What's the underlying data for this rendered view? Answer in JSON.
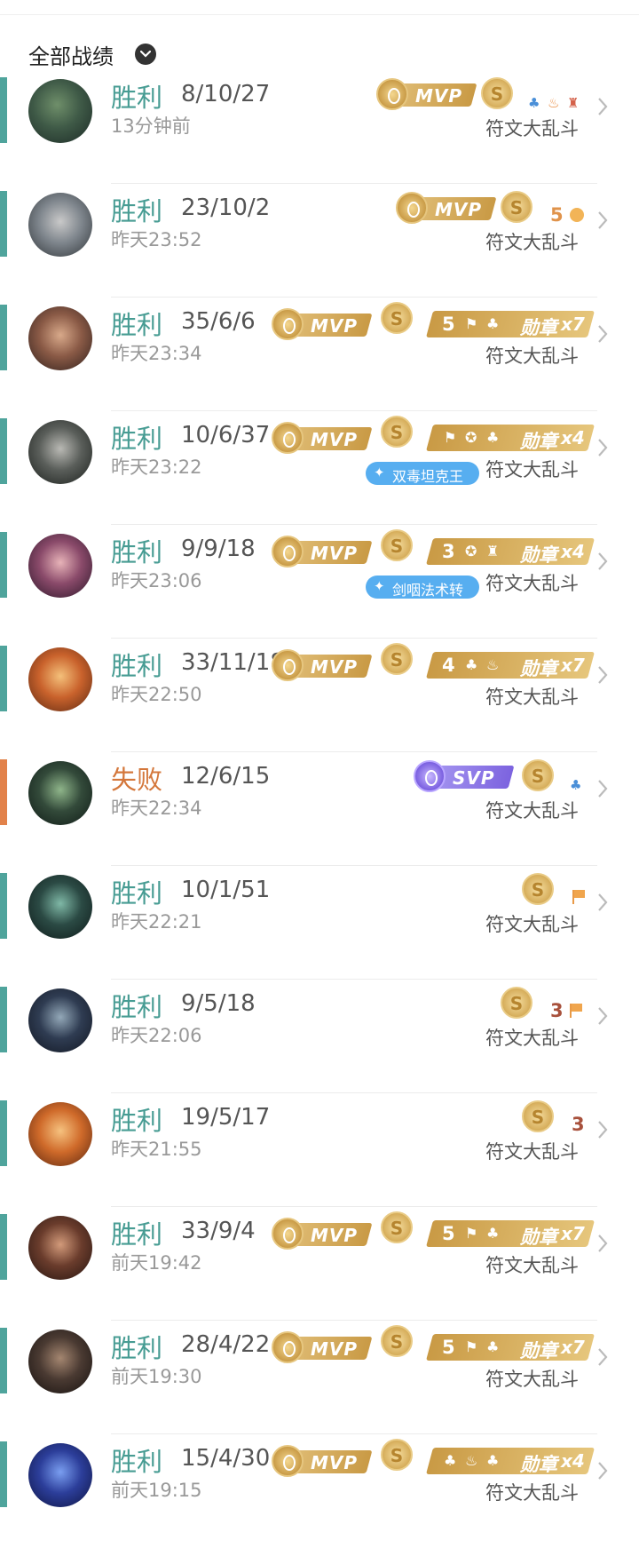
{
  "header": {
    "title": "全部战绩"
  },
  "mode_label": "符文大乱斗",
  "badges": {
    "mvp": "MVP",
    "svp": "SVP",
    "s": "S",
    "medal_word": "勋章"
  },
  "colors": {
    "win": "#479c93",
    "loss": "#d4773b",
    "gold": "#c99a45",
    "svp": "#7c63df",
    "tag": "#57aef0"
  },
  "matches": [
    {
      "result": "胜利",
      "kda": "8/10/27",
      "time": "13分钟前",
      "mode": "符文大乱斗"
    },
    {
      "result": "胜利",
      "kda": "23/10/2",
      "time": "昨天23:52",
      "mode": "符文大乱斗",
      "mini_count": "5"
    },
    {
      "result": "胜利",
      "kda": "35/6/6",
      "time": "昨天23:34",
      "mode": "符文大乱斗",
      "medal_lead": "5",
      "medal_mult": "x7"
    },
    {
      "result": "胜利",
      "kda": "10/6/37",
      "time": "昨天23:22",
      "mode": "符文大乱斗",
      "medal_mult": "x4",
      "tag": "双毒坦克王"
    },
    {
      "result": "胜利",
      "kda": "9/9/18",
      "time": "昨天23:06",
      "mode": "符文大乱斗",
      "medal_lead": "3",
      "medal_mult": "x4",
      "tag": "剑咽法术转"
    },
    {
      "result": "胜利",
      "kda": "33/11/18",
      "time": "昨天22:50",
      "mode": "符文大乱斗",
      "medal_lead": "4",
      "medal_mult": "x7"
    },
    {
      "result": "失败",
      "kda": "12/6/15",
      "time": "昨天22:34",
      "mode": "符文大乱斗"
    },
    {
      "result": "胜利",
      "kda": "10/1/51",
      "time": "昨天22:21",
      "mode": "符文大乱斗"
    },
    {
      "result": "胜利",
      "kda": "9/5/18",
      "time": "昨天22:06",
      "mode": "符文大乱斗",
      "mini_count": "3"
    },
    {
      "result": "胜利",
      "kda": "19/5/17",
      "time": "昨天21:55",
      "mode": "符文大乱斗",
      "mini_count": "3"
    },
    {
      "result": "胜利",
      "kda": "33/9/4",
      "time": "前天19:42",
      "mode": "符文大乱斗",
      "medal_lead": "5",
      "medal_mult": "x7"
    },
    {
      "result": "胜利",
      "kda": "28/4/22",
      "time": "前天19:30",
      "mode": "符文大乱斗",
      "medal_lead": "5",
      "medal_mult": "x7"
    },
    {
      "result": "胜利",
      "kda": "15/4/30",
      "time": "前天19:15",
      "mode": "符文大乱斗",
      "medal_mult": "x4"
    }
  ]
}
